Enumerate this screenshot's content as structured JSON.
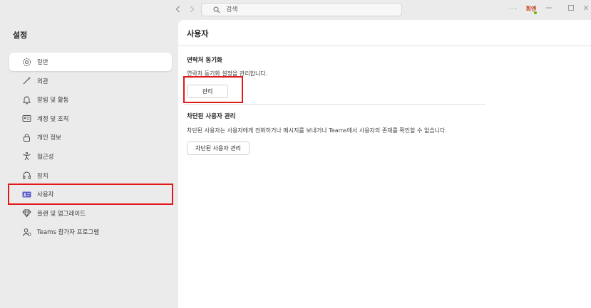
{
  "titlebar": {
    "search_placeholder": "검색",
    "avatar_initials": "회엔"
  },
  "sidebar": {
    "title": "설정",
    "items": [
      {
        "label": "일반",
        "icon": "gear-icon"
      },
      {
        "label": "외관",
        "icon": "magic-wand-icon"
      },
      {
        "label": "알림 및 활동",
        "icon": "bell-icon"
      },
      {
        "label": "계정 및 조직",
        "icon": "id-card-icon"
      },
      {
        "label": "개인 정보",
        "icon": "lock-icon"
      },
      {
        "label": "접근성",
        "icon": "accessibility-icon"
      },
      {
        "label": "장치",
        "icon": "headset-icon"
      },
      {
        "label": "사용자",
        "icon": "people-card-icon"
      },
      {
        "label": "플랜 및 업그레이드",
        "icon": "diamond-icon"
      },
      {
        "label": "Teams 참가자 프로그램",
        "icon": "person-program-icon"
      }
    ]
  },
  "main": {
    "title": "사용자",
    "contact_sync": {
      "heading": "연락처 동기화",
      "description": "연락처 동기화 설정을 관리합니다.",
      "button_label": "관리"
    },
    "blocked": {
      "heading": "차단된 사용자 관리",
      "description": "차단된 사용자는 사용자에게 전화하거나 메시지를 보내거나 Teams에서 사용자의 존재를 확인할 수 없습니다.",
      "button_label": "차단된 사용자 관리"
    }
  },
  "colors": {
    "highlight_red": "#e31818",
    "accent_purple": "#5b5fc7",
    "sidebar_bg": "#ebebeb"
  }
}
